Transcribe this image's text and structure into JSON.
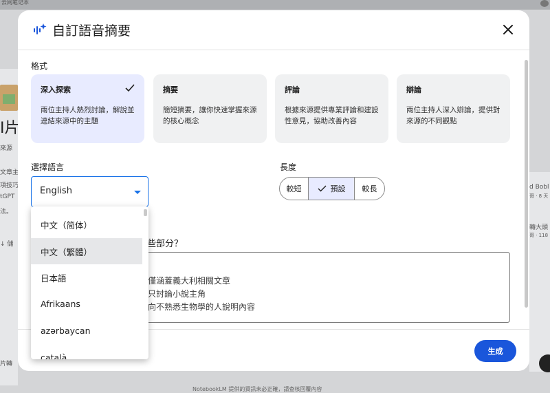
{
  "background": {
    "top_left_text": "云网笔记本",
    "left_fragments": [
      "I片",
      "來源",
      "文章主",
      "項技巧",
      "tGPT",
      "法。",
      "↓ 儲",
      "片轉"
    ],
    "right_fragments": [
      "d Bobl",
      "哥 · 8 天",
      "轉大頭",
      "哥 · 118"
    ],
    "bottom_text": "NotebookLM 提供的資訊未必正確，請查核回覆內容"
  },
  "dialog": {
    "title": "自訂語音摘要",
    "format_label": "格式",
    "formats": [
      {
        "title": "深入探索",
        "desc": "兩位主持人熱烈討論，解說並連結來源中的主題",
        "selected": true
      },
      {
        "title": "摘要",
        "desc": "簡短摘要，讓你快速掌握來源的核心概念",
        "selected": false
      },
      {
        "title": "評論",
        "desc": "根據來源提供專業評論和建設性意見，協助改善內容",
        "selected": false
      },
      {
        "title": "辯論",
        "desc": "兩位主持人深入辯論，提供對來源的不同觀點",
        "selected": false
      }
    ],
    "language_label": "選擇語言",
    "language_value": "English",
    "length_label": "長度",
    "length_options": [
      "較短",
      "預設",
      "較長"
    ],
    "length_selected": "預設",
    "prompt_label_fragment": "些部分？",
    "prompt_lines": [
      "僅涵蓋義大利相關文章",
      "只討論小說主角",
      "向不熟悉生物學的人說明內容"
    ],
    "generate_label": "生成"
  },
  "dropdown": {
    "options": [
      "中文（简体）",
      "中文（繁體）",
      "日本語",
      "Afrikaans",
      "azərbaycan",
      "català"
    ],
    "hovered": "中文（繁體）"
  },
  "colors": {
    "accent": "#1a73e8",
    "generate_button": "#1a56db",
    "selected_card": "#e8ebff"
  }
}
